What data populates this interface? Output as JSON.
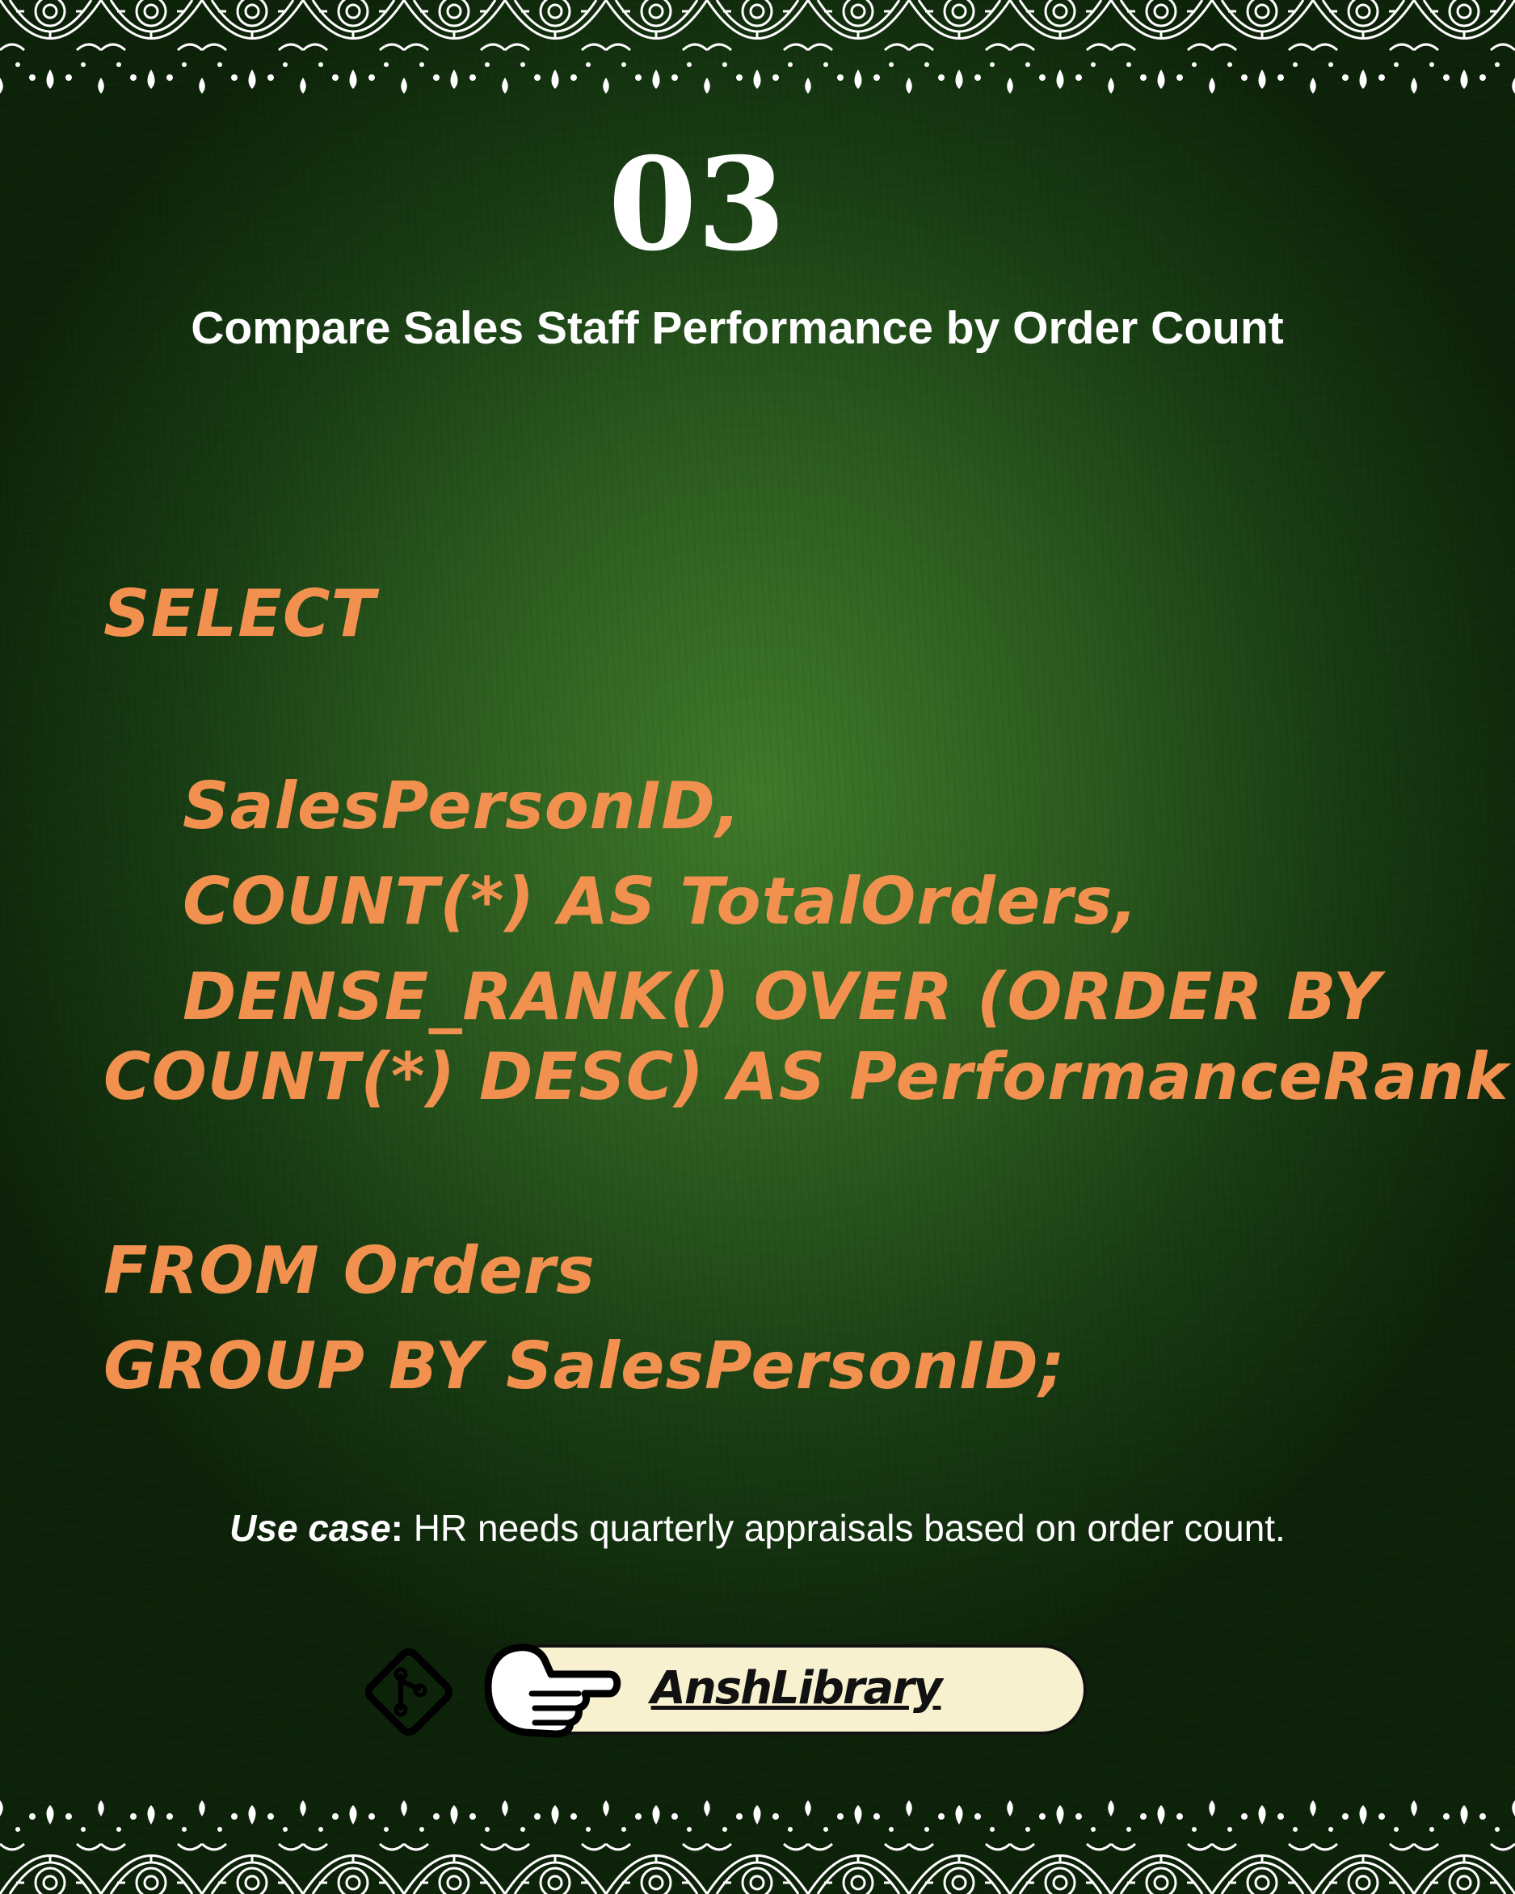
{
  "slide_number": "03",
  "title": "Compare Sales Staff Performance by Order Count",
  "code": {
    "select": "SELECT",
    "col1": "SalesPersonID,",
    "col2": "COUNT(*) AS TotalOrders,",
    "col3a": "DENSE_RANK() OVER (ORDER BY",
    "col3b": "COUNT(*) DESC) AS PerformanceRank",
    "from": "FROM Orders",
    "group": "GROUP BY SalesPersonID;"
  },
  "use_case": {
    "label": "Use case",
    "colon": ":",
    "text": " HR needs quarterly appraisals based on order count."
  },
  "brand": "AnshLibrary",
  "colors": {
    "code": "#f2914f",
    "background": "#2c5c1f",
    "pill": "#f7f1cf"
  },
  "icons": [
    "git-icon",
    "pointing-hand-icon"
  ]
}
